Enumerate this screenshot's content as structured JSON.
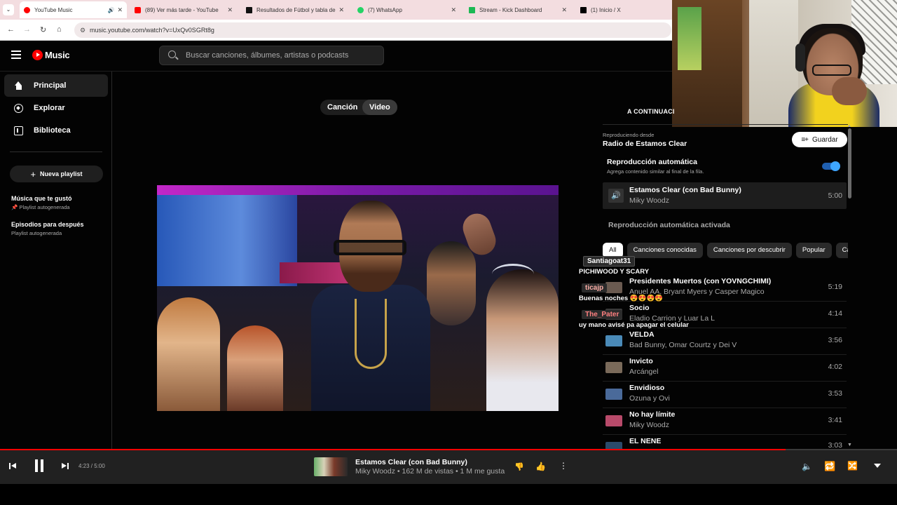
{
  "browser": {
    "tabs": [
      {
        "label": "YouTube Music",
        "color": "#ff0000",
        "active": true
      },
      {
        "label": "(89) Ver más tarde - YouTube",
        "color": "#ff0000"
      },
      {
        "label": "Resultados de Fútbol y tabla de",
        "color": "#111111"
      },
      {
        "label": "(7) WhatsApp",
        "color": "#25d366"
      },
      {
        "label": "Stream - Kick Dashboard",
        "color": "#1db954"
      },
      {
        "label": "(1) Inicio / X",
        "color": "#000000"
      }
    ],
    "url": "music.youtube.com/watch?v=UxQv0SGRt8g"
  },
  "header": {
    "logo_text": "Music",
    "search_placeholder": "Buscar canciones, álbumes, artistas o podcasts"
  },
  "sidebar": {
    "nav": [
      {
        "label": "Principal",
        "icon": "home-icon"
      },
      {
        "label": "Explorar",
        "icon": "compass-icon"
      },
      {
        "label": "Biblioteca",
        "icon": "library-icon"
      }
    ],
    "new_playlist": "Nueva playlist",
    "playlists": [
      {
        "title": "Música que te gustó",
        "subtitle": "Playlist autogenerada",
        "pinned": true
      },
      {
        "title": "Episodios para después",
        "subtitle": "Playlist autogenerada"
      }
    ]
  },
  "main": {
    "toggle": [
      "Canción",
      "Video"
    ],
    "toggle_selected": "Video"
  },
  "queue": {
    "up_next": "A CONTINUACI",
    "playing_from_label": "Reproduciendo desde",
    "playing_from": "Radio de Estamos Clear",
    "save_label": "Guardar",
    "autoplay_title": "Reproducción automática",
    "autoplay_subtitle": "Agrega contenido similar al final de la fila.",
    "current": {
      "title": "Estamos Clear (con Bad Bunny)",
      "artist": "Miky Woodz",
      "duration": "5:00"
    },
    "autoplay_active": "Reproducción automática activada",
    "chips": [
      "All",
      "Canciones conocidas",
      "Canciones por descubrir",
      "Popular",
      "Ca"
    ],
    "items": [
      {
        "title": "Presidentes Muertos (con YOVNGCHIMI)",
        "artist": "Anuel AA, Bryant Myers y Casper Magico",
        "duration": "5:19",
        "thumb": "#6a5a50"
      },
      {
        "title": "Socio",
        "artist": "Eladio Carrion y Luar La L",
        "duration": "4:14",
        "thumb": "#3a3a3a"
      },
      {
        "title": "VELDA",
        "artist": "Bad Bunny, Omar Courtz y Dei V",
        "duration": "3:56",
        "thumb": "#4a8ab8"
      },
      {
        "title": "Invicto",
        "artist": "Arcángel",
        "duration": "4:02",
        "thumb": "#7a6a5a"
      },
      {
        "title": "Envidioso",
        "artist": "Ozuna y Ovi",
        "duration": "3:53",
        "thumb": "#4a6a9a"
      },
      {
        "title": "No hay límite",
        "artist": "Miky Woodz",
        "duration": "3:41",
        "thumb": "#b84a6a"
      },
      {
        "title": "EL NENE",
        "artist": "",
        "duration": "3:03",
        "thumb": "#2a4a6a"
      }
    ]
  },
  "chat": [
    {
      "user": "Santiagoat31",
      "message": "PICHIWOOD Y SCARY"
    },
    {
      "user": "ticajp",
      "message": "Buenas noches 😍😍😍😍"
    },
    {
      "user": "The_Pater",
      "message": "uy mano avisé pa apagar el celular"
    }
  ],
  "player": {
    "time": "4:23 / 5:00",
    "progress_fraction": 0.876,
    "title": "Estamos Clear (con Bad Bunny)",
    "subtitle": "Miky Woodz • 162 M de vistas • 1 M me gusta"
  }
}
